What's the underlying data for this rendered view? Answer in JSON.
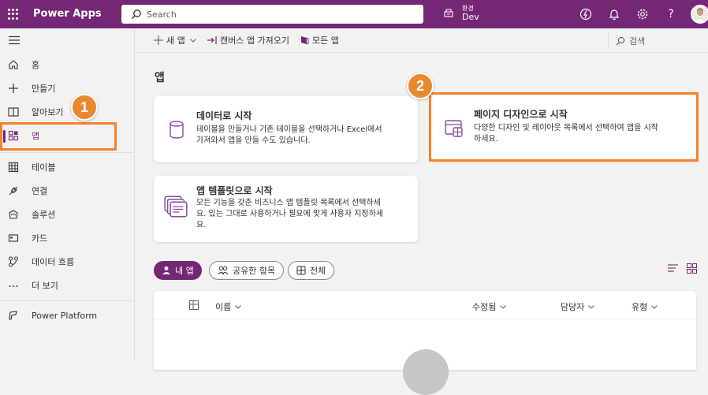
{
  "topbar": {
    "app_name": "Power Apps",
    "search_placeholder": "Search",
    "environment_label": "환경",
    "environment_value": "Dev",
    "icons": [
      "environment-icon",
      "copilot-icon",
      "bell-icon",
      "gear-icon",
      "help-icon",
      "avatar"
    ]
  },
  "commandbar": {
    "new_app": "새 앱",
    "import_canvas": "캔버스 앱 가져오기",
    "all_apps": "모든 앱",
    "search": "검색"
  },
  "leftnav": {
    "items": [
      {
        "label": "홈",
        "icon": "home-icon"
      },
      {
        "label": "만들기",
        "icon": "plus-icon"
      },
      {
        "label": "알아보기",
        "icon": "book-icon"
      },
      {
        "label": "앱",
        "icon": "apps-icon",
        "active": true
      },
      {
        "label": "테이블",
        "icon": "table-icon"
      },
      {
        "label": "연결",
        "icon": "connection-icon"
      },
      {
        "label": "솔루션",
        "icon": "solution-icon"
      },
      {
        "label": "카드",
        "icon": "card-icon"
      },
      {
        "label": "데이터 흐름",
        "icon": "dataflow-icon"
      },
      {
        "label": "더 보기",
        "icon": "more-icon"
      },
      {
        "label": "Power Platform",
        "icon": "power-platform-icon"
      }
    ]
  },
  "main": {
    "title": "앱",
    "cards": [
      {
        "title": "데이터로 시작",
        "description_lines": [
          "테이블을 만들거나 기존 테이블을 선택하거나 Excel에서",
          "가져와서 앱을 만들 수도 있습니다."
        ],
        "icon": "database-icon"
      },
      {
        "title": "페이지 디자인으로 시작",
        "description_lines": [
          "다양한 디자인 및 레이아웃 목록에서 선택하여 앱을 시작",
          "하세요."
        ],
        "icon": "page-design-icon"
      },
      {
        "title": "앱 템플릿으로 시작",
        "description_lines": [
          "모든 기능을 갖춘 비즈니스 앱 템플릿 목록에서 선택하세",
          "요. 있는 그대로 사용하거나 필요에 맞게 사용자 지정하세",
          "요."
        ],
        "icon": "app-template-icon"
      }
    ],
    "filters": [
      {
        "label": "내 앱",
        "active": true
      },
      {
        "label": "공유한 항목",
        "active": false
      },
      {
        "label": "전체",
        "active": false
      }
    ],
    "columns": [
      "이름",
      "수정됨",
      "담당자",
      "유형"
    ]
  },
  "annotations": {
    "badge_1": "1",
    "badge_2": "2",
    "highlight_color": "#f7812a"
  },
  "colors": {
    "brand": "#742774",
    "accent_icon": "#8a4a9e"
  }
}
